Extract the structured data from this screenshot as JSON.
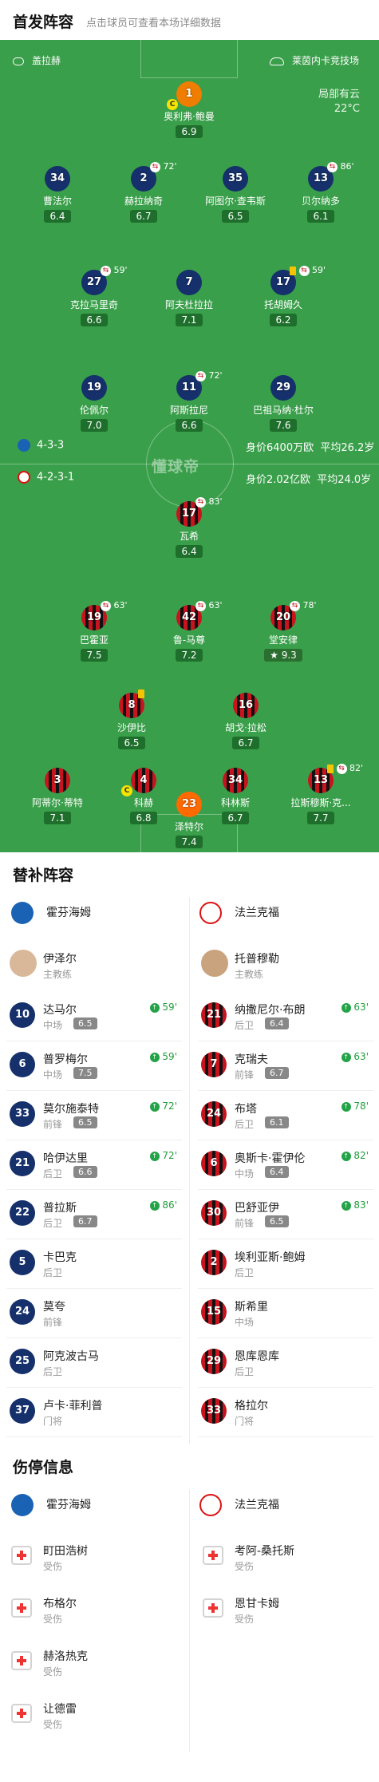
{
  "header": {
    "title": "首发阵容",
    "subtitle": "点击球员可查看本场详细数据"
  },
  "pitch": {
    "home_coach_label": "盖拉赫",
    "stadium": "莱茵内卡竞技场",
    "weather_1": "局部有云",
    "weather_2": "22°C",
    "watermark": "懂球帝",
    "home_formation": "4-3-3",
    "home_value": "身价6400万欧",
    "home_age": "平均26.2岁",
    "away_formation": "4-2-3-1",
    "away_value": "身价2.02亿欧",
    "away_age": "平均24.0岁"
  },
  "home_players": [
    {
      "num": "1",
      "name": "奥利弗·鲍曼",
      "rating": "6.9",
      "sub": ""
    },
    {
      "num": "34",
      "name": "曹法尔",
      "rating": "6.4",
      "sub": ""
    },
    {
      "num": "2",
      "name": "赫拉纳奇",
      "rating": "6.7",
      "sub": "72'"
    },
    {
      "num": "35",
      "name": "阿图尔·查韦斯",
      "rating": "6.5",
      "sub": ""
    },
    {
      "num": "13",
      "name": "贝尔纳多",
      "rating": "6.1",
      "sub": "86'"
    },
    {
      "num": "27",
      "name": "克拉马里奇",
      "rating": "6.6",
      "sub": "59'"
    },
    {
      "num": "7",
      "name": "阿夫杜拉拉",
      "rating": "7.1",
      "sub": ""
    },
    {
      "num": "17",
      "name": "托胡姆久",
      "rating": "6.2",
      "sub": "59'"
    },
    {
      "num": "19",
      "name": "伦佩尔",
      "rating": "7.0",
      "sub": ""
    },
    {
      "num": "11",
      "name": "阿斯拉尼",
      "rating": "6.6",
      "sub": "72'"
    },
    {
      "num": "29",
      "name": "巴祖马纳·杜尔",
      "rating": "7.6",
      "sub": ""
    }
  ],
  "away_players": [
    {
      "num": "17",
      "name": "瓦希",
      "rating": "6.4",
      "sub": "83'"
    },
    {
      "num": "19",
      "name": "巴霍亚",
      "rating": "7.5",
      "sub": "63'"
    },
    {
      "num": "42",
      "name": "鲁-马尊",
      "rating": "7.2",
      "sub": "63'"
    },
    {
      "num": "20",
      "name": "堂安律",
      "rating": "9.3",
      "sub": "78'"
    },
    {
      "num": "8",
      "name": "沙伊比",
      "rating": "6.5",
      "sub": ""
    },
    {
      "num": "16",
      "name": "胡戈·拉松",
      "rating": "6.7",
      "sub": ""
    },
    {
      "num": "3",
      "name": "阿蒂尔·蒂特",
      "rating": "7.1",
      "sub": ""
    },
    {
      "num": "4",
      "name": "科赫",
      "rating": "6.8",
      "sub": ""
    },
    {
      "num": "34",
      "name": "科林斯",
      "rating": "6.7",
      "sub": ""
    },
    {
      "num": "13",
      "name": "拉斯穆斯·克...",
      "rating": "7.7",
      "sub": "82'"
    },
    {
      "num": "23",
      "name": "泽特尔",
      "rating": "7.4",
      "sub": ""
    }
  ],
  "subs": {
    "title": "替补阵容",
    "home_team": "霍芬海姆",
    "away_team": "法兰克福",
    "home_coach": {
      "name": "伊泽尔",
      "role": "主教练"
    },
    "away_coach": {
      "name": "托普穆勒",
      "role": "主教练"
    },
    "home": [
      {
        "num": "10",
        "name": "达马尔",
        "pos": "中场",
        "rating": "6.5",
        "time": "59'"
      },
      {
        "num": "6",
        "name": "普罗梅尔",
        "pos": "中场",
        "rating": "7.5",
        "time": "59'"
      },
      {
        "num": "33",
        "name": "莫尔施泰特",
        "pos": "前锋",
        "rating": "6.5",
        "time": "72'"
      },
      {
        "num": "21",
        "name": "哈伊达里",
        "pos": "后卫",
        "rating": "6.6",
        "time": "72'"
      },
      {
        "num": "22",
        "name": "普拉斯",
        "pos": "后卫",
        "rating": "6.7",
        "time": "86'"
      },
      {
        "num": "5",
        "name": "卡巴克",
        "pos": "后卫",
        "rating": "",
        "time": ""
      },
      {
        "num": "24",
        "name": "莫夸",
        "pos": "前锋",
        "rating": "",
        "time": ""
      },
      {
        "num": "25",
        "name": "阿克波古马",
        "pos": "后卫",
        "rating": "",
        "time": ""
      },
      {
        "num": "37",
        "name": "卢卡·菲利普",
        "pos": "门将",
        "rating": "",
        "time": ""
      }
    ],
    "away": [
      {
        "num": "21",
        "name": "纳撒尼尔·布朗",
        "pos": "后卫",
        "rating": "6.4",
        "time": "63'"
      },
      {
        "num": "7",
        "name": "克瑞夫",
        "pos": "前锋",
        "rating": "6.7",
        "time": "63'"
      },
      {
        "num": "24",
        "name": "布塔",
        "pos": "后卫",
        "rating": "6.1",
        "time": "78'"
      },
      {
        "num": "6",
        "name": "奥斯卡·霍伊伦",
        "pos": "中场",
        "rating": "6.4",
        "time": "82'"
      },
      {
        "num": "30",
        "name": "巴舒亚伊",
        "pos": "前锋",
        "rating": "6.5",
        "time": "83'"
      },
      {
        "num": "2",
        "name": "埃利亚斯·鲍姆",
        "pos": "后卫",
        "rating": "",
        "time": ""
      },
      {
        "num": "15",
        "name": "斯希里",
        "pos": "中场",
        "rating": "",
        "time": ""
      },
      {
        "num": "29",
        "name": "恩库恩库",
        "pos": "后卫",
        "rating": "",
        "time": ""
      },
      {
        "num": "33",
        "name": "格拉尔",
        "pos": "门将",
        "rating": "",
        "time": ""
      }
    ]
  },
  "injuries": {
    "title": "伤停信息",
    "home": [
      {
        "name": "町田浩树",
        "status": "受伤"
      },
      {
        "name": "布格尔",
        "status": "受伤"
      },
      {
        "name": "赫洛热克",
        "status": "受伤"
      },
      {
        "name": "让德雷",
        "status": "受伤"
      }
    ],
    "away": [
      {
        "name": "考阿-桑托斯",
        "status": "受伤"
      },
      {
        "name": "恩甘卡姆",
        "status": "受伤"
      }
    ]
  }
}
